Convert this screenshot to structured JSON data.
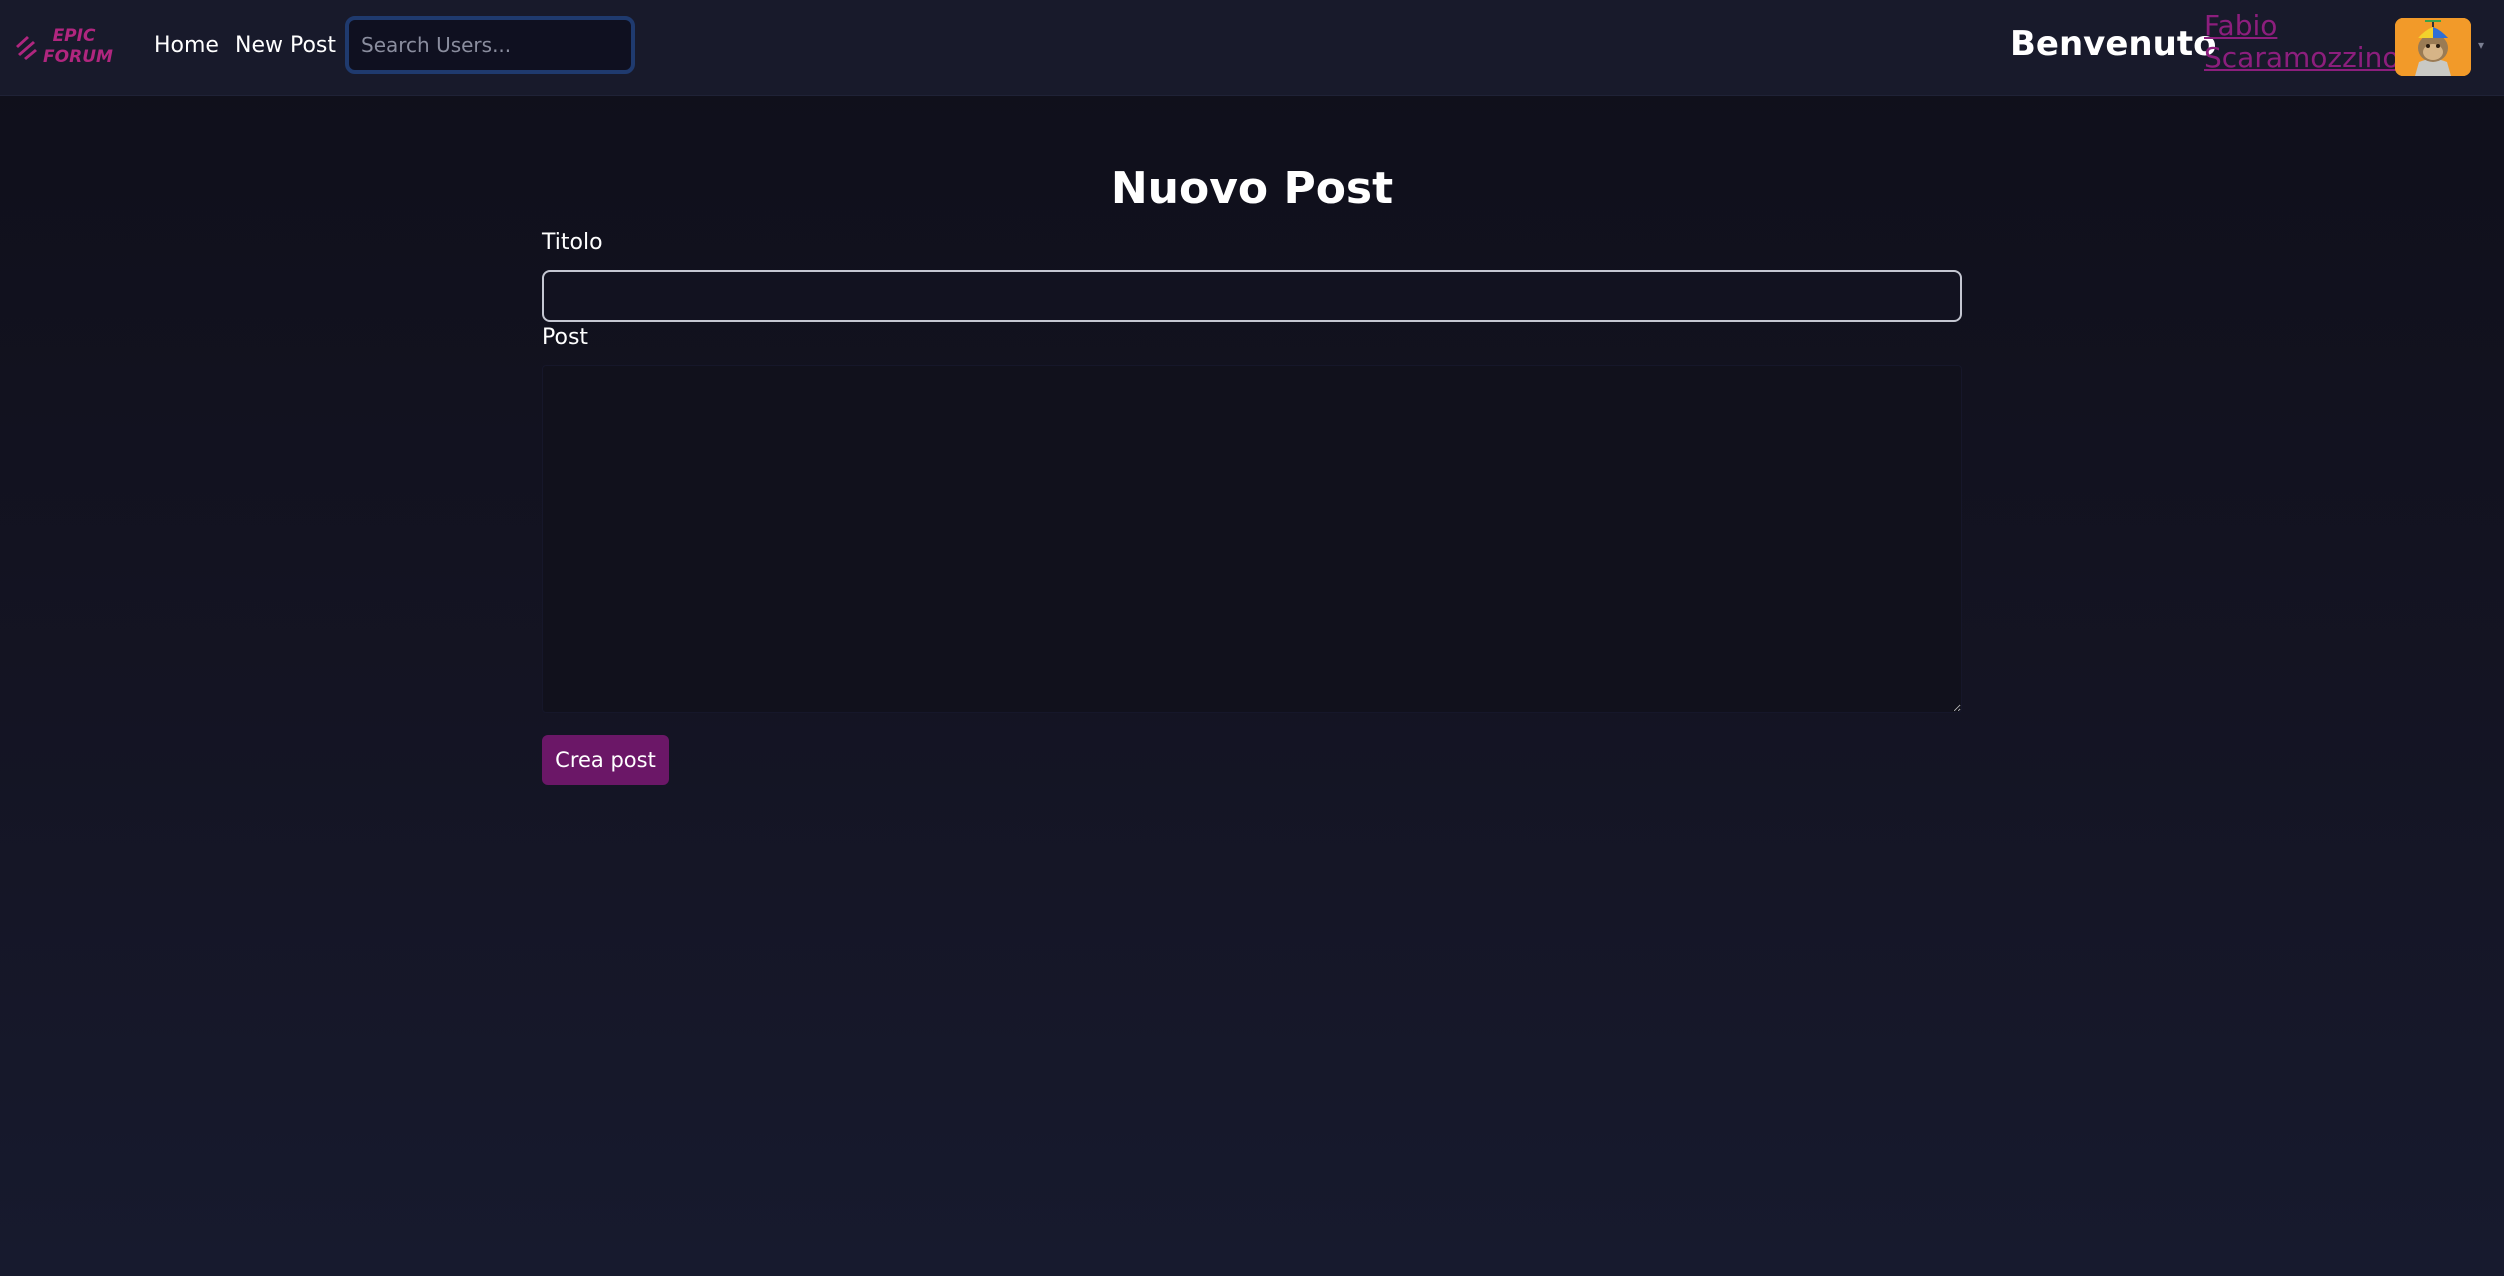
{
  "brand": {
    "logo_text_line1": "EPIC",
    "logo_text_line2": "FORUM",
    "logo_icon": "slash-bolt-icon",
    "accent_color": "#b0267f"
  },
  "nav": {
    "home_label": "Home",
    "new_post_label": "New Post"
  },
  "search": {
    "placeholder": "Search Users...",
    "value": "",
    "icon": "search-input-focused"
  },
  "user": {
    "welcome_label": "Benvenuto",
    "name": "Fabio Scaramozzino",
    "name_color": "#8c1e7d",
    "avatar_icon": "avatar-ape-icon",
    "dropdown_icon": "caret-down-icon"
  },
  "form": {
    "heading": "Nuovo Post",
    "title_label": "Titolo",
    "title_value": "",
    "post_label": "Post",
    "post_value": "",
    "submit_label": "Crea post",
    "submit_color": "#6b1767"
  },
  "colors": {
    "background": "#141423",
    "navbar": "#181a2b",
    "search_focus_ring": "#1f3a6e"
  }
}
